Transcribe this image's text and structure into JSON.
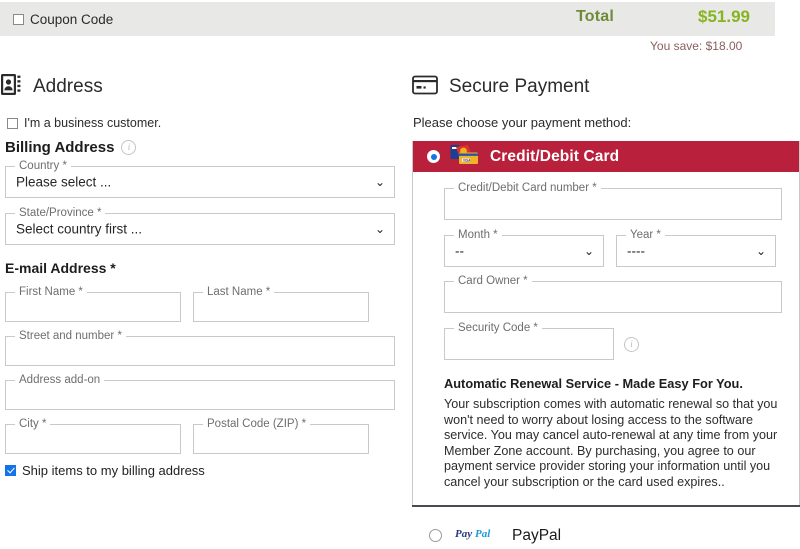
{
  "topbar": {
    "coupon_label": "Coupon Code",
    "total_label": "Total",
    "total_value": "$51.99",
    "you_save": "You save: $18.00",
    "colors": {
      "bar_bg": "#e8e8e6",
      "total_label_color": "#6f8b3a",
      "total_value_color": "#86b521",
      "you_save_color": "#8a5f5f"
    }
  },
  "address": {
    "heading": "Address",
    "heading_icon": "address-book-icon",
    "business_customer_label": "I'm a business customer.",
    "business_customer_checked": false,
    "billing_heading": "Billing Address",
    "billing_info_icon": "info-icon",
    "country": {
      "label": "Country *",
      "value": "Please select ...",
      "chevron": "⌄"
    },
    "state": {
      "label": "State/Province *",
      "value": "Select country first ...",
      "chevron": "⌄"
    },
    "email_heading": "E-mail Address *",
    "first_name": {
      "label": "First Name *",
      "value": ""
    },
    "last_name": {
      "label": "Last Name *",
      "value": ""
    },
    "street": {
      "label": "Street and number *",
      "value": ""
    },
    "address_addon": {
      "label": "Address add-on",
      "value": ""
    },
    "city": {
      "label": "City *",
      "value": ""
    },
    "postal_code": {
      "label": "Postal Code (ZIP) *",
      "value": ""
    },
    "ship_label": "Ship items to my billing address",
    "ship_checked": true
  },
  "payment": {
    "heading": "Secure Payment",
    "heading_icon": "credit-card-icon",
    "choose_text": "Please choose your payment method:",
    "methods": [
      {
        "id": "credit-debit-card",
        "label": "Credit/Debit Card",
        "selected": true,
        "icon": "card-stack-icon",
        "header_color": "#b9203b"
      },
      {
        "id": "paypal",
        "label": "PayPal",
        "selected": false,
        "icon": "paypal-logo-icon"
      }
    ],
    "card_number": {
      "label": "Credit/Debit Card number *",
      "value": ""
    },
    "month": {
      "label": "Month *",
      "value": "--",
      "chevron": "⌄"
    },
    "year": {
      "label": "Year *",
      "value": "----",
      "chevron": "⌄"
    },
    "card_owner": {
      "label": "Card Owner *",
      "value": ""
    },
    "security_code": {
      "label": "Security Code *",
      "value": "",
      "info_icon": "info-icon"
    },
    "renewal_title": "Automatic Renewal Service - Made Easy For You.",
    "renewal_text": "Your subscription comes with automatic renewal so that you won't need to worry about losing access to the software service. You may cancel auto-renewal at any time from your Member Zone account. By purchasing, you agree to our payment service provider storing your information until you cancel your subscription or the card used expires.."
  }
}
